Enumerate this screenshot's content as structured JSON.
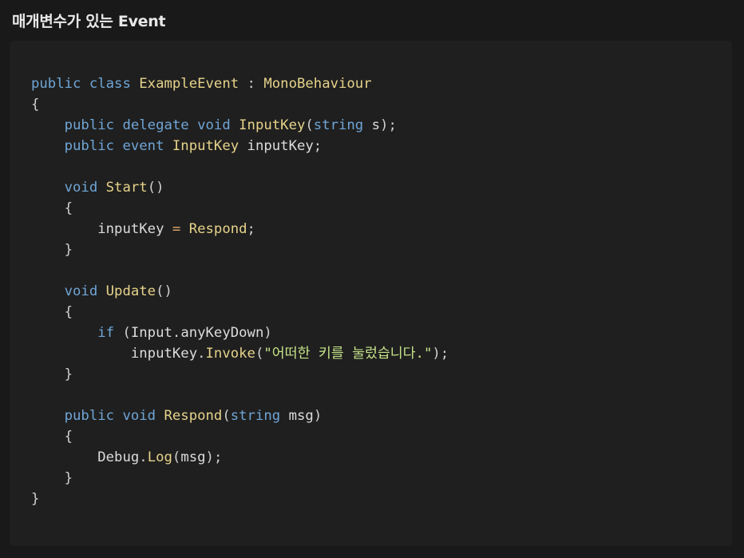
{
  "heading": "매개변수가 있는 Event",
  "code": {
    "language": "csharp",
    "lines": [
      "public class ExampleEvent : MonoBehaviour",
      "{",
      "    public delegate void InputKey(string s);",
      "    public event InputKey inputKey;",
      "",
      "    void Start()",
      "    {",
      "        inputKey = Respond;",
      "    }",
      "",
      "    void Update()",
      "    {",
      "        if (Input.anyKeyDown)",
      "            inputKey.Invoke(\"어떠한 키를 눌렀습니다.\");",
      "    }",
      "",
      "    public void Respond(string msg)",
      "    {",
      "        Debug.Log(msg);",
      "    }",
      "}"
    ]
  },
  "colors": {
    "background": "#191919",
    "code_background": "#1f1f1f",
    "keyword": "#6fa5d6",
    "type_or_method": "#e6d38a",
    "string_text": "#c6e38a",
    "operator": "#e0a96d",
    "plain": "#dcdcdc"
  }
}
